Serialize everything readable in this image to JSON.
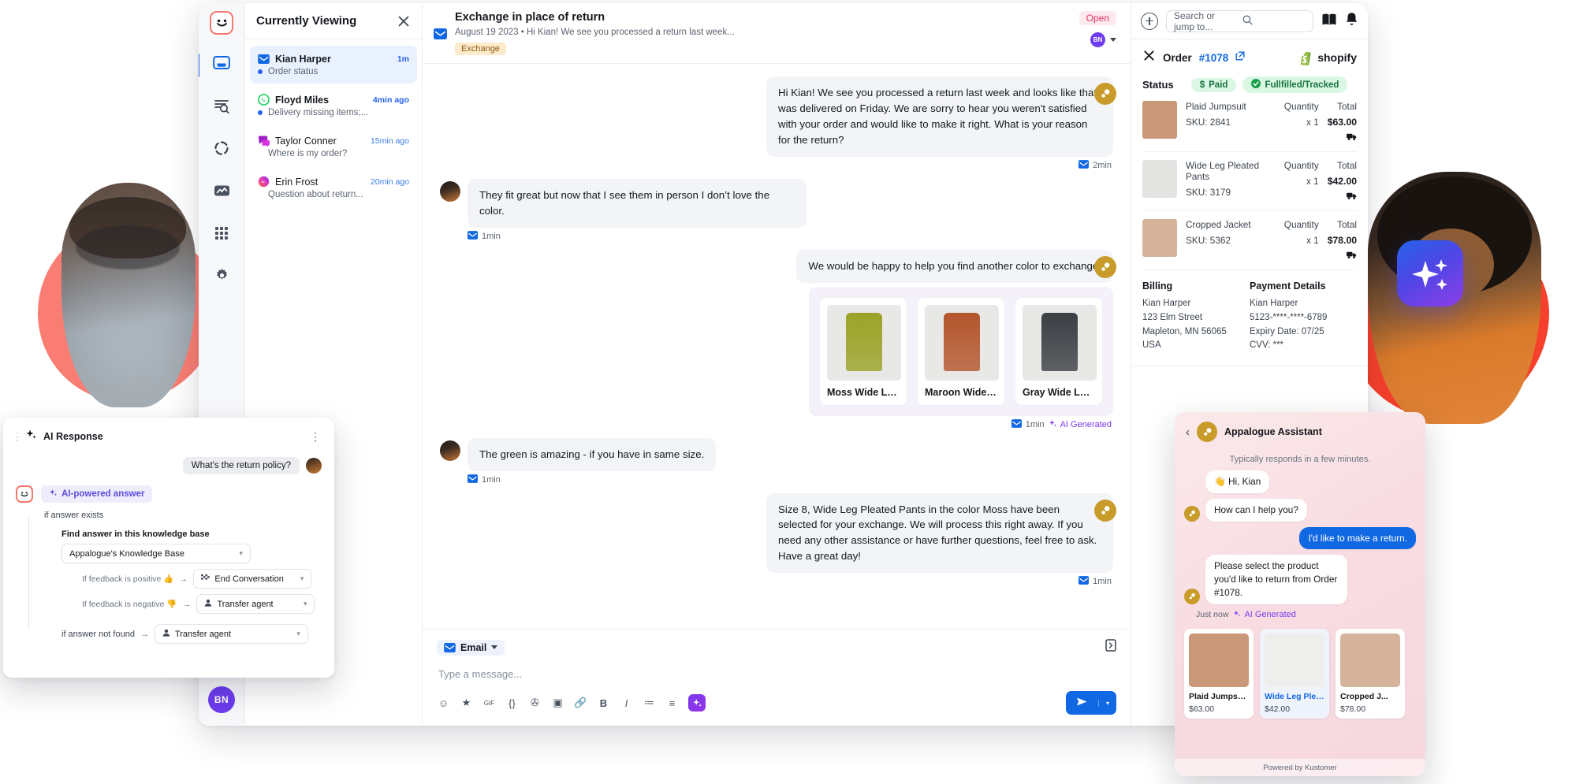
{
  "rail": {
    "logo_icon": "kustomer-smiley-logo",
    "items": [
      {
        "name": "inbox",
        "icon": "inbox-icon",
        "active": true
      },
      {
        "name": "search",
        "icon": "filter-search-icon",
        "active": false
      },
      {
        "name": "workflows",
        "icon": "refresh-circle-icon",
        "active": false
      },
      {
        "name": "reports",
        "icon": "analytics-icon",
        "active": false
      },
      {
        "name": "apps",
        "icon": "grid-apps-icon",
        "active": false
      },
      {
        "name": "settings",
        "icon": "gear-icon",
        "active": false
      }
    ],
    "avatar_initials": "BN"
  },
  "conversation_list": {
    "title": "Currently Viewing",
    "close_icon": "close-icon",
    "items": [
      {
        "name": "Kian Harper",
        "preview": "Order status",
        "time": "1m",
        "channel": "email-icon",
        "selected": true,
        "unread": true
      },
      {
        "name": "Floyd Miles",
        "preview": "Delivery missing items;...",
        "time": "4min ago",
        "channel": "whatsapp-icon",
        "selected": false,
        "unread": true
      },
      {
        "name": "Taylor Conner",
        "preview": "Where is my order?",
        "time": "15min ago",
        "channel": "chat-icon",
        "selected": false,
        "unread": false
      },
      {
        "name": "Erin Frost",
        "preview": "Question about return...",
        "time": "20min ago",
        "channel": "messenger-icon",
        "selected": false,
        "unread": false
      }
    ]
  },
  "thread": {
    "channel_icon": "email-icon",
    "title": "Exchange in place of return",
    "subtitle": "August 19 2023  •  Hi Kian! We see you processed a return last week...",
    "tag": "Exchange",
    "status": "Open",
    "assignee_initials": "BN",
    "messages": [
      {
        "dir": "out",
        "text": "Hi Kian! We see you processed a return last week and looks like that was delivered on Friday. We are sorry to hear you weren't satisfied with your order and would like to make it right. What is your reason for the return?",
        "meta": "2min",
        "brand": true
      },
      {
        "dir": "in",
        "text": "They fit great but now that I see them in person I don’t love the color.",
        "meta": "1min"
      },
      {
        "dir": "out",
        "text": "We would be happy to help you find another color to exchange.",
        "meta": "",
        "brand": true
      },
      {
        "dir": "cards",
        "meta": "1min",
        "ai_label": "AI Generated"
      },
      {
        "dir": "in",
        "text": "The green is amazing - if you have in same size.",
        "meta": "1min"
      },
      {
        "dir": "out",
        "text": "Size 8, Wide Leg Pleated Pants in the color Moss have been selected for your exchange. We will process this right away. If you need any other assistance or have further questions, feel free to ask. Have a great day!",
        "meta": "1min",
        "brand": true
      }
    ],
    "product_cards": [
      {
        "name": "Moss Wide Leg...",
        "color": "#9AA326"
      },
      {
        "name": "Maroon Wide L...",
        "color": "#B4552C"
      },
      {
        "name": "Gray Wide Leg...",
        "color": "#3B3E43"
      }
    ]
  },
  "composer": {
    "channel_label": "Email",
    "channel_icon": "email-icon",
    "placeholder": "Type a message...",
    "shortcut_icon": "shortcut-icon",
    "tools": [
      {
        "name": "emoji-icon",
        "glyph": "☺"
      },
      {
        "name": "sticker-icon",
        "glyph": "★"
      },
      {
        "name": "gif-icon",
        "glyph": "GIF"
      },
      {
        "name": "snippet-icon",
        "glyph": "{}"
      },
      {
        "name": "attachment-icon",
        "glyph": "✇"
      },
      {
        "name": "image-icon",
        "glyph": "▣"
      },
      {
        "name": "link-icon",
        "glyph": "🔗"
      },
      {
        "name": "bold-icon",
        "glyph": "B"
      },
      {
        "name": "italic-icon",
        "glyph": "I"
      },
      {
        "name": "ordered-list-icon",
        "glyph": "≔"
      },
      {
        "name": "bullet-list-icon",
        "glyph": "≡"
      }
    ],
    "ai_icon": "ai-sparkle-icon",
    "send_icon": "send-icon",
    "send_caret": "▾"
  },
  "right_panel": {
    "add_icon": "plus-icon",
    "search_placeholder": "Search or jump to...",
    "search_icon": "search-icon",
    "kb_icon": "knowledge-book-icon",
    "bell_icon": "bell-icon",
    "close_icon": "close-icon",
    "order_label": "Order",
    "order_number": "#1078",
    "external_link_icon": "external-link-icon",
    "integration": "shopify",
    "status_label": "Status",
    "status_paid": "Paid",
    "status_paid_icon": "dollar-icon",
    "status_fulfilled": "Fullfilled/Tracked",
    "status_fulfilled_icon": "check-circle-icon",
    "col_qty": "Quantity",
    "col_total": "Total",
    "items": [
      {
        "name": "Plaid Jumpsuit",
        "sku": "SKU: 2841",
        "qty": "x 1",
        "total": "$63.00",
        "thumb": "#C89878"
      },
      {
        "name": "Wide Leg Pleated Pants",
        "sku": "SKU: 3179",
        "qty": "x 1",
        "total": "$42.00",
        "thumb": "#E3E4E2"
      },
      {
        "name": "Cropped Jacket",
        "sku": "SKU: 5362",
        "qty": "x 1",
        "total": "$78.00",
        "thumb": "#D6B49B"
      }
    ],
    "billing_heading": "Billing",
    "billing_lines": [
      "Kian Harper",
      "123 Elm Street",
      "Mapleton, MN 56065",
      "USA"
    ],
    "payment_heading": "Payment Details",
    "payment_lines": [
      "Kian Harper",
      "5123-****-****-6789",
      "Expiry Date: 07/25",
      "CVV: ***"
    ]
  },
  "ai_response_panel": {
    "title": "AI Response",
    "title_icon": "ai-sparkle-icon",
    "kebab_icon": "more-vertical-icon",
    "question": "What's the return policy?",
    "answer_pill": "AI-powered answer",
    "branch_exists": "if answer exists",
    "kb_heading": "Find answer in this knowledge base",
    "kb_value": "Appalogue's Knowledge Base",
    "feedback_positive_label": "If feedback is positive 👍",
    "feedback_positive_value": "End Conversation",
    "feedback_positive_icon": "checkered-flag-icon",
    "feedback_negative_label": "If feedback is negative 👎",
    "feedback_negative_value": "Transfer agent",
    "feedback_negative_icon": "person-icon",
    "not_found_label": "if answer not found",
    "not_found_value": "Transfer agent",
    "not_found_icon": "person-icon",
    "arrow": "→"
  },
  "widget": {
    "back_icon": "chevron-left-icon",
    "avatar_icon": "appalogue-logo",
    "title": "Appalogue Assistant",
    "typical": "Typically responds in a few minutes.",
    "messages": [
      {
        "dir": "in",
        "text": "👋 Hi, Kian",
        "avatar": false
      },
      {
        "dir": "in",
        "text": "How can I help you?",
        "avatar": true
      },
      {
        "dir": "out",
        "text": "I'd like to make a return."
      },
      {
        "dir": "in",
        "text": "Please select the product you'd like to return from Order #1078.",
        "avatar": true
      }
    ],
    "meta_time": "Just now",
    "meta_ai": "AI Generated",
    "cards": [
      {
        "name": "Plaid Jumpsuit...",
        "price": "$63.00",
        "selected": false,
        "thumb": "#C89878"
      },
      {
        "name": "Wide Leg Pleat...",
        "price": "$42.00",
        "selected": true,
        "thumb": "#EEEEEC"
      },
      {
        "name": "Cropped J...",
        "price": "$78.00",
        "selected": false,
        "thumb": "#D6B49B"
      }
    ],
    "footer": "Powered by Kustomer"
  },
  "decor": {
    "ai_badge_icon": "ai-sparkle-icon",
    "agent_photo": "support-agent-photo",
    "customer_photo": "customer-photo"
  },
  "colors": {
    "accent_blue": "#1168E3",
    "brand_coral": "#F4796E",
    "ai_purple": "#7C3AED",
    "status_open": "#E0346A",
    "status_green": "#17733E",
    "brand_gold": "#C89B2A"
  }
}
